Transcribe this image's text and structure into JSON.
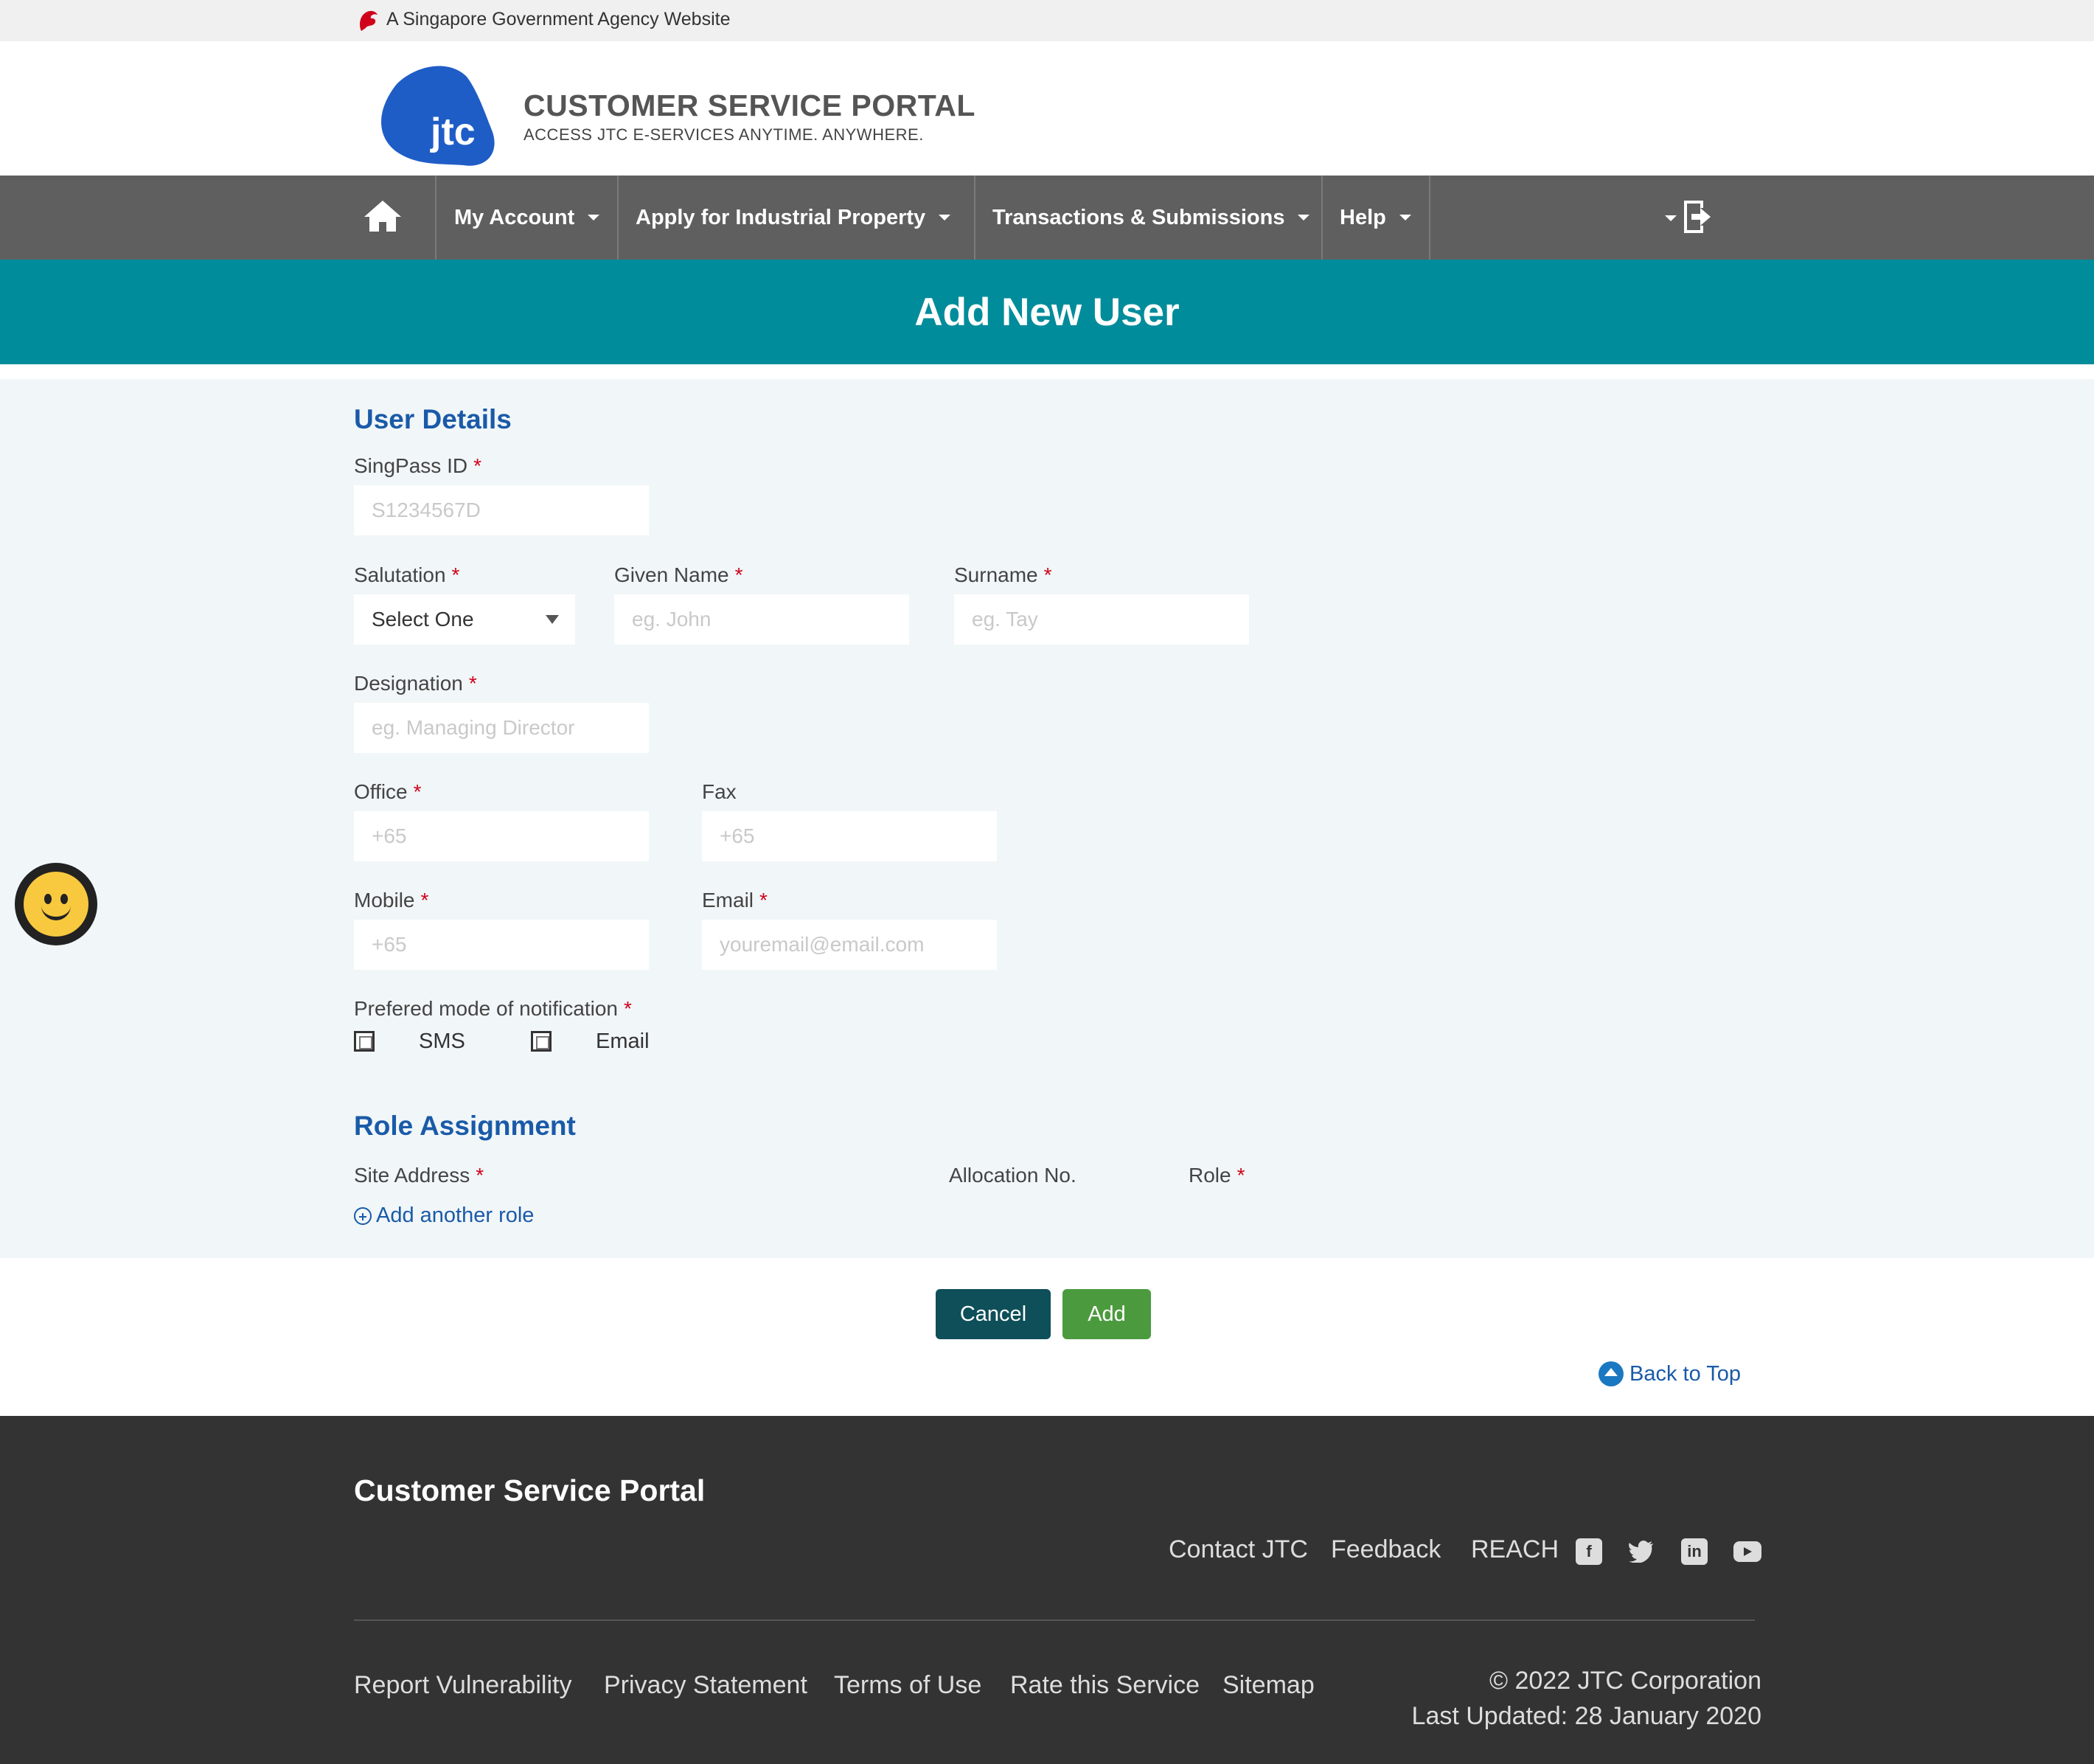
{
  "masthead": {
    "text": "A Singapore Government Agency Website"
  },
  "header": {
    "logo_text": "jtc",
    "title": "CUSTOMER SERVICE PORTAL",
    "subtitle": "ACCESS JTC E-SERVICES ANYTIME. ANYWHERE."
  },
  "nav": {
    "items": [
      {
        "label": "My Account"
      },
      {
        "label": "Apply for Industrial Property"
      },
      {
        "label": "Transactions & Submissions"
      },
      {
        "label": "Help"
      }
    ],
    "icons": {
      "home": "home-icon",
      "logout": "logout-icon"
    }
  },
  "banner": {
    "title": "Add New User"
  },
  "user_details": {
    "title": "User Details",
    "singpass": {
      "label": "SingPass ID",
      "placeholder": "S1234567D"
    },
    "salutation": {
      "label": "Salutation",
      "value": "Select One"
    },
    "given_name": {
      "label": "Given Name",
      "placeholder": "eg. John"
    },
    "surname": {
      "label": "Surname",
      "placeholder": "eg. Tay"
    },
    "designation": {
      "label": "Designation",
      "placeholder": "eg. Managing Director"
    },
    "office": {
      "label": "Office",
      "placeholder": "+65"
    },
    "fax": {
      "label": "Fax",
      "placeholder": "+65"
    },
    "mobile": {
      "label": "Mobile",
      "placeholder": "+65"
    },
    "email": {
      "label": "Email",
      "placeholder": "youremail@email.com"
    },
    "notification": {
      "label": "Prefered mode of notification",
      "options": [
        "SMS",
        "Email"
      ]
    },
    "required_mark": "*"
  },
  "role_assignment": {
    "title": "Role Assignment",
    "site_address": "Site Address",
    "allocation_no": "Allocation No.",
    "role": "Role",
    "add_role": "Add another role"
  },
  "actions": {
    "cancel": "Cancel",
    "add": "Add",
    "back_to_top": "Back to Top"
  },
  "footer": {
    "title": "Customer Service Portal",
    "links_top": [
      "Contact JTC",
      "Feedback",
      "REACH"
    ],
    "social": [
      "facebook-icon",
      "twitter-icon",
      "linkedin-icon",
      "youtube-icon"
    ],
    "links_bottom": [
      "Report Vulnerability",
      "Privacy Statement",
      "Terms of Use",
      "Rate this Service",
      "Sitemap"
    ],
    "copyright": "© 2022 JTC Corporation",
    "last_updated": "Last Updated: 28 January 2020"
  },
  "colors": {
    "banner": "#008c9b",
    "nav": "#5f5f5f",
    "section_title": "#1a5aa8",
    "cancel": "#0e4f59",
    "add": "#4c9a3e",
    "footer": "#333333"
  }
}
